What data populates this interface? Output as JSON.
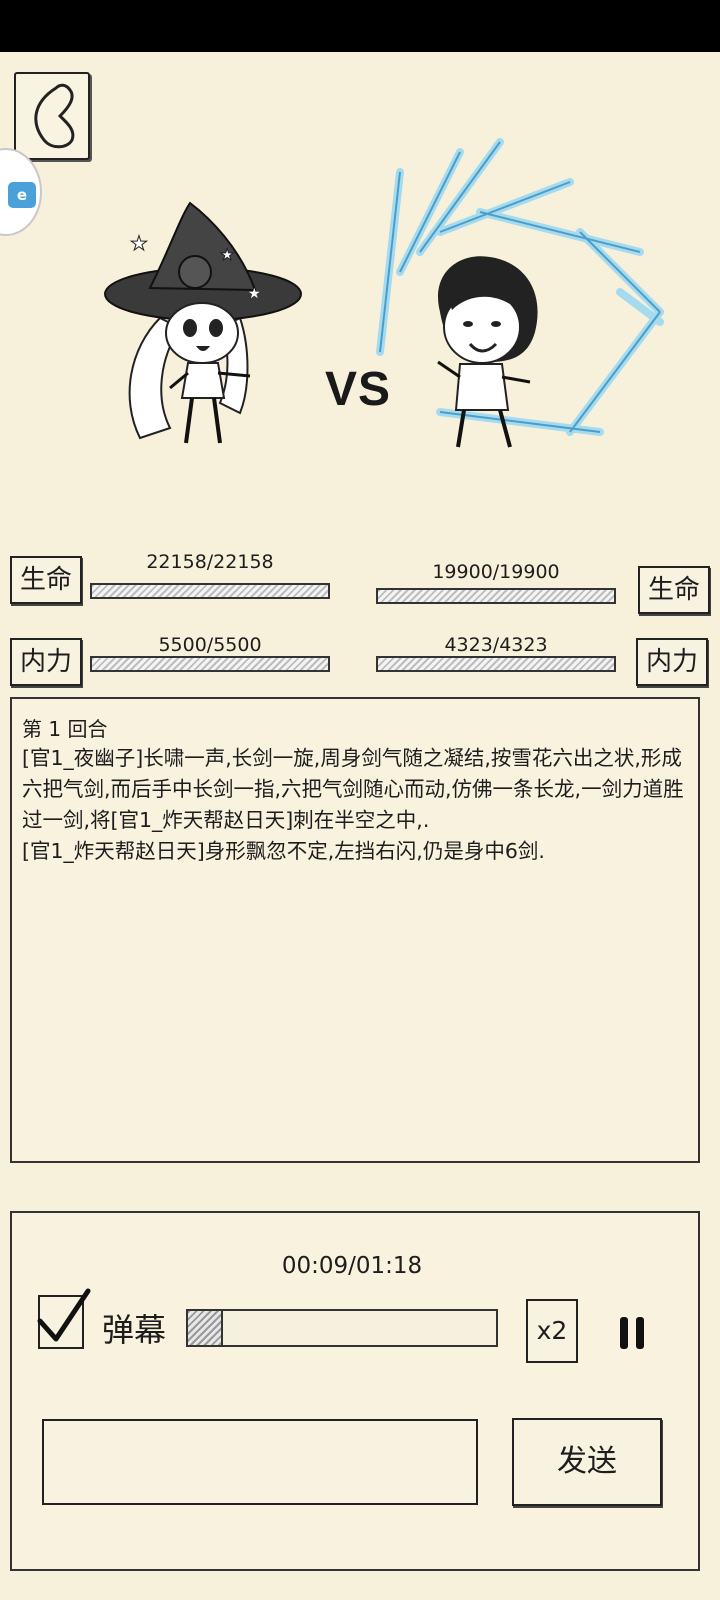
{
  "battle": {
    "vs_label": "VS",
    "left": {
      "hp_label": "生命",
      "hp_text": "22158/22158",
      "hp_fraction": 1.0,
      "mp_label": "内力",
      "mp_text": "5500/5500",
      "mp_fraction": 1.0
    },
    "right": {
      "hp_label": "生命",
      "hp_text": "19900/19900",
      "hp_fraction": 1.0,
      "mp_label": "内力",
      "mp_text": "4323/4323",
      "mp_fraction": 1.0
    }
  },
  "log": {
    "round_label": "第 1 回合",
    "lines": "[官1_夜幽子]长啸一声,长剑一旋,周身剑气随之凝结,按雪花六出之状,形成六把气剑,而后手中长剑一指,六把气剑随心而动,仿佛一条长龙,一剑力道胜过一剑,将[官1_炸天帮赵日天]刺在半空之中,.\n[官1_炸天帮赵日天]身形飘忽不定,左挡右闪,仍是身中6剑."
  },
  "controls": {
    "time": "00:09/01:18",
    "progress_fraction": 0.115,
    "danmu_label": "弹幕",
    "danmu_checked": true,
    "speed_label": "x2",
    "input_placeholder": "",
    "send_label": "发送"
  },
  "side_badge": "e",
  "colors": {
    "background": "#f7f1dc",
    "ink": "#1d1d1d",
    "ice": "#8fd0ee"
  }
}
